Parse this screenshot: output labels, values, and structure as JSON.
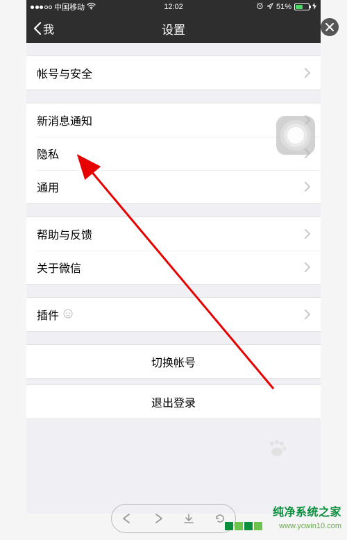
{
  "statusbar": {
    "carrier": "中国移动",
    "time": "12:02",
    "battery_pct": "51%"
  },
  "nav": {
    "back_label": "我",
    "title": "设置"
  },
  "groups": {
    "account": {
      "label": "帐号与安全"
    },
    "notify": {
      "label": "新消息通知"
    },
    "privacy": {
      "label": "隐私"
    },
    "general": {
      "label": "通用"
    },
    "help": {
      "label": "帮助与反馈"
    },
    "about": {
      "label": "关于微信"
    },
    "plugins": {
      "label": "插件"
    }
  },
  "actions": {
    "switch_account": "切换帐号",
    "logout": "退出登录"
  },
  "watermark": {
    "title": "纯净系统之家",
    "url": "www.ycwin10.com"
  }
}
